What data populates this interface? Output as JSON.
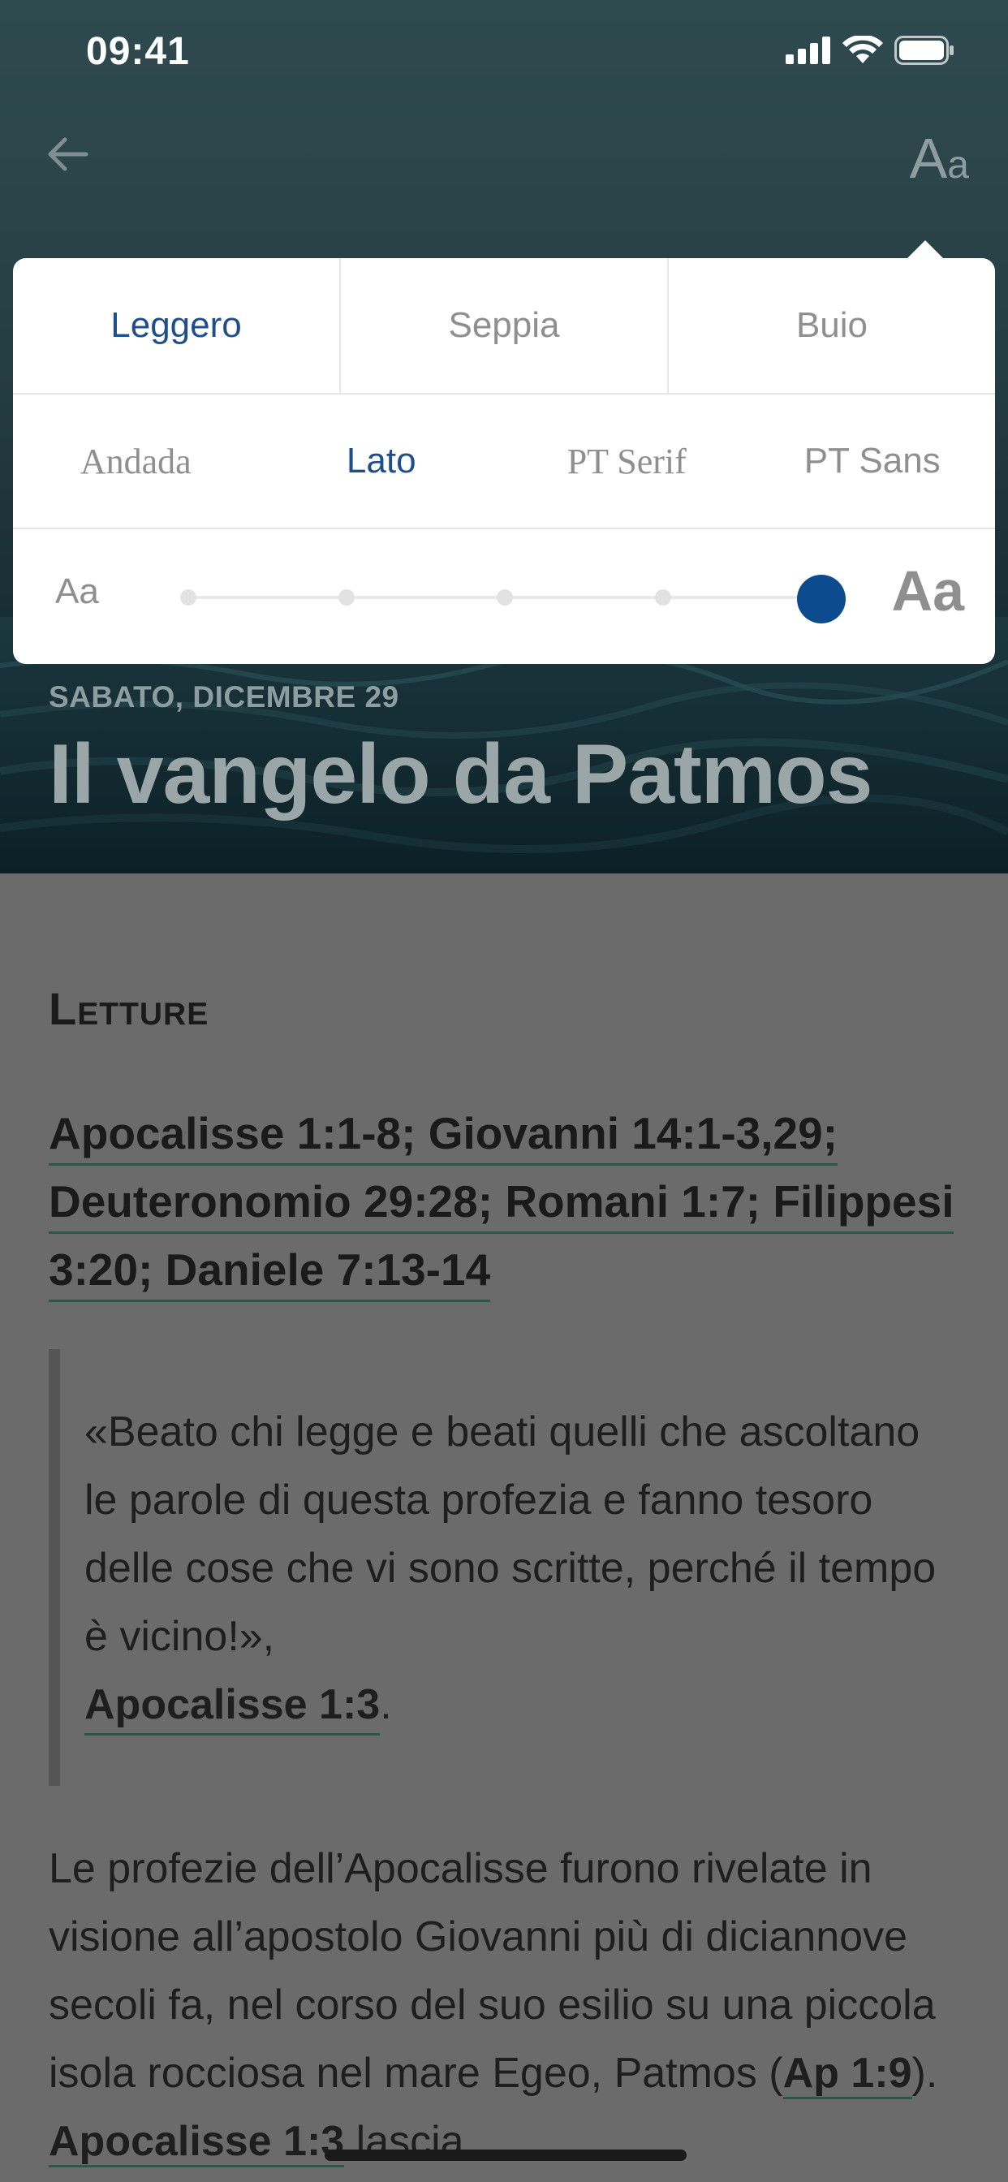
{
  "status_bar": {
    "time": "09:41"
  },
  "header": {
    "aa_big": "A",
    "aa_small": "a",
    "date": "SABATO, DICEMBRE 29",
    "title": "Il vangelo da Patmos"
  },
  "popover": {
    "themes": [
      {
        "label": "Leggero",
        "active": true
      },
      {
        "label": "Seppia",
        "active": false
      },
      {
        "label": "Buio",
        "active": false
      }
    ],
    "fonts": [
      {
        "label": "Andada",
        "active": false
      },
      {
        "label": "Lato",
        "active": true
      },
      {
        "label": "PT Serif",
        "active": false
      },
      {
        "label": "PT Sans",
        "active": false
      }
    ],
    "size": {
      "small_label": "Aa",
      "large_label": "Aa",
      "steps": 5,
      "selected_step": 5
    },
    "accent_color": "#0d4b8f"
  },
  "content": {
    "section_title": "Letture",
    "readings": "Apocalisse 1:1-8; Giovanni 14:1-3,29; Deuteronomio 29:28; Romani 1:7; Filippesi 3:20; Daniele 7:13-14",
    "quote_text": "«Beato chi legge e beati quelli che ascoltano le parole di questa profezia e fanno tesoro delle cose che vi sono scritte, perché il tempo è vicino!»,",
    "quote_ref": "Apocalisse 1:3",
    "quote_end": ".",
    "para_start": "Le profezie dell’Apocalisse furono rivelate in visione all’apostolo Giovanni più di diciannove secoli fa, nel corso del suo esilio su una piccola isola rocciosa nel mare Egeo, Patmos (",
    "para_ref1": "Ap 1:9",
    "para_mid": "). ",
    "para_ref2": "Apocalisse 1:3",
    "para_end": " lascia"
  }
}
